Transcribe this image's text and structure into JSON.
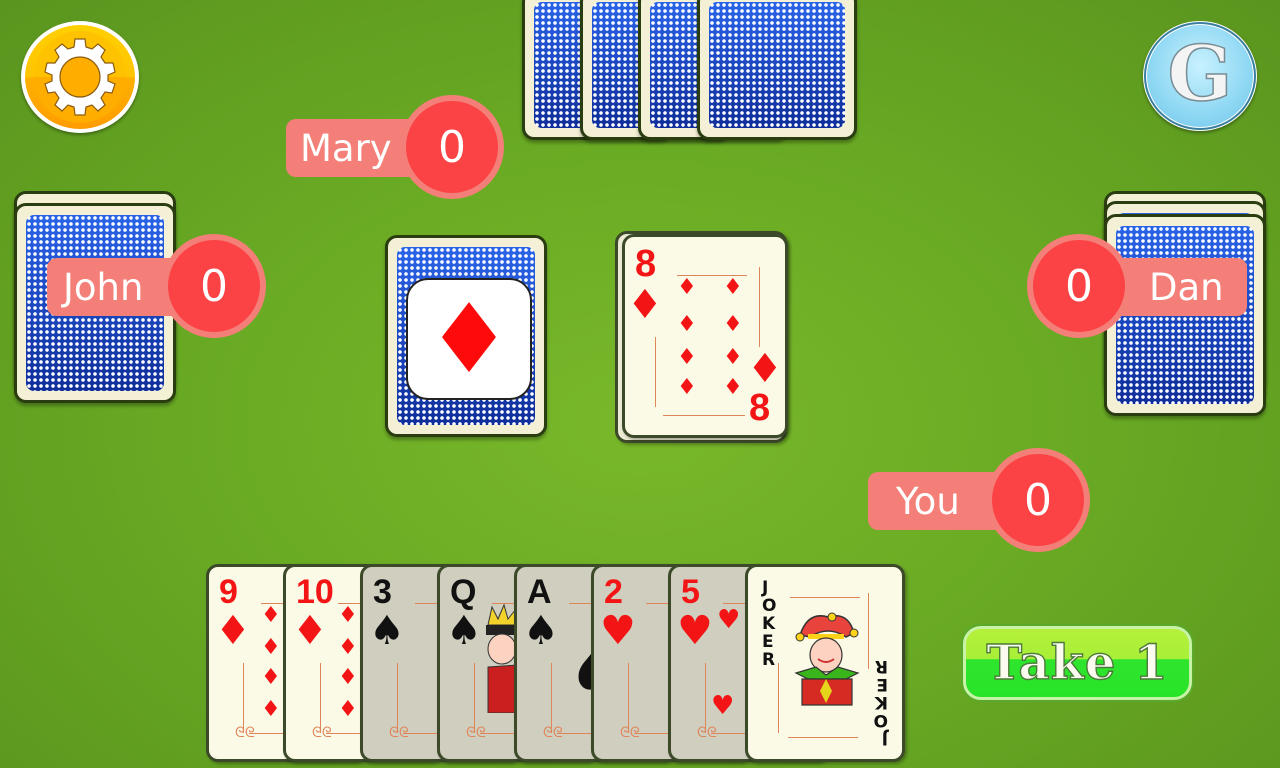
{
  "buttons": {
    "settings_icon": "gear-icon",
    "games_label": "G",
    "take_label": "Take 1"
  },
  "players": {
    "mary": {
      "name": "Mary",
      "score": "0"
    },
    "john": {
      "name": "John",
      "score": "0"
    },
    "dan": {
      "name": "Dan",
      "score": "0"
    },
    "you": {
      "name": "You",
      "score": "0"
    }
  },
  "table": {
    "trump_suit": "♦",
    "trump_suit_name": "diamonds",
    "played_card": {
      "rank": "8",
      "suit": "♦",
      "suit_name": "diamonds"
    }
  },
  "hand": [
    {
      "rank": "9",
      "suit": "♦",
      "color": "red",
      "playable": true
    },
    {
      "rank": "10",
      "suit": "♦",
      "color": "red",
      "playable": true
    },
    {
      "rank": "3",
      "suit": "♠",
      "color": "black",
      "playable": false
    },
    {
      "rank": "Q",
      "suit": "♠",
      "color": "black",
      "playable": false
    },
    {
      "rank": "A",
      "suit": "♠",
      "color": "black",
      "playable": false
    },
    {
      "rank": "2",
      "suit": "♥",
      "color": "red",
      "playable": false
    },
    {
      "rank": "5",
      "suit": "♥",
      "color": "red",
      "playable": false
    },
    {
      "rank": "JOKER",
      "suit": "",
      "color": "black",
      "playable": true
    }
  ],
  "opponent_cards": {
    "mary_visible": 4,
    "john_visible": 2,
    "dan_visible": 3
  },
  "colors": {
    "table_green": "#6aab24",
    "badge_label": "#f47f78",
    "badge_count": "#fb4245",
    "card_back_blue": "#1d47c9",
    "suit_red": "#f31515",
    "take_button_green": "#2ee52e"
  }
}
